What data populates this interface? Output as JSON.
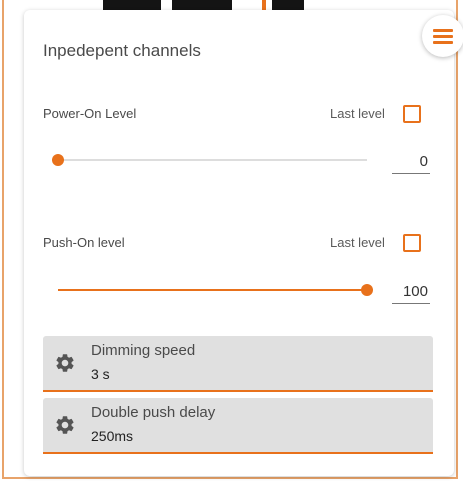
{
  "title": "Inpedepent channels",
  "power_on": {
    "label": "Power-On Level",
    "last_level_label": "Last level",
    "last_level_checked": false,
    "value": "0",
    "level_percent": 0
  },
  "push_on": {
    "label": "Push-On level",
    "last_level_label": "Last level",
    "last_level_checked": false,
    "value": "100",
    "level_percent": 100
  },
  "settings": [
    {
      "label": "Dimming speed",
      "value": "3 s",
      "icon": "gear-icon"
    },
    {
      "label": "Double push delay",
      "value": "250ms",
      "icon": "gear-icon"
    }
  ],
  "menu_icon": "hamburger-menu-icon",
  "colors": {
    "accent": "#e8711b",
    "setting_bg": "#e0e0e0",
    "border": "#e8a36a"
  }
}
